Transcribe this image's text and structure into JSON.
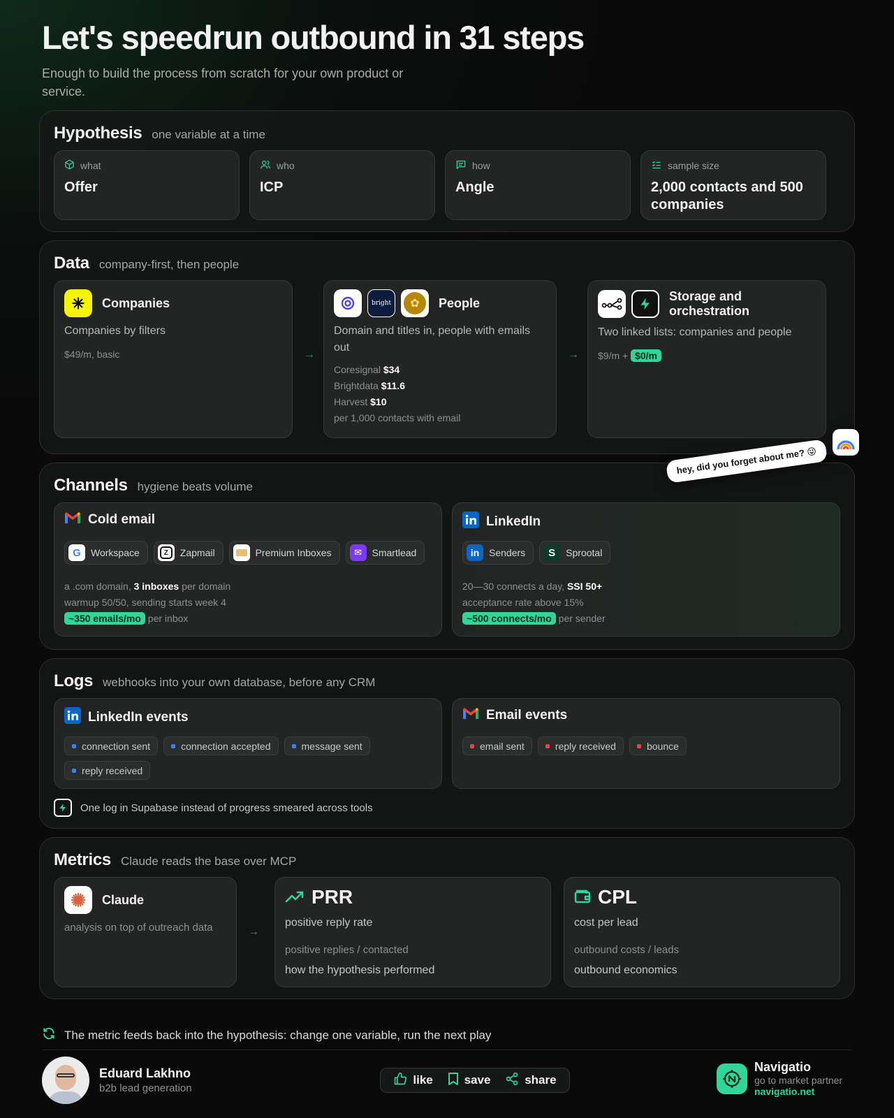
{
  "header": {
    "title": "Let's speedrun outbound in 31 steps",
    "subtitle": "Enough to build the process from scratch for your own product or service."
  },
  "hypothesis": {
    "title": "Hypothesis",
    "subtitle": "one variable at a time",
    "cards": [
      {
        "label": "what",
        "value": "Offer",
        "icon": "cube-icon"
      },
      {
        "label": "who",
        "value": "ICP",
        "icon": "users-icon"
      },
      {
        "label": "how",
        "value": "Angle",
        "icon": "message-icon"
      },
      {
        "label": "sample size",
        "value": "2,000 contacts and 500 companies",
        "icon": "checklist-icon"
      }
    ]
  },
  "data": {
    "title": "Data",
    "subtitle": "company-first, then people",
    "companies": {
      "title": "Companies",
      "desc": "Companies by filters",
      "price": "$49/m, basic"
    },
    "people": {
      "title": "People",
      "desc": "Domain and titles in, people with emails out",
      "vendors": [
        {
          "name": "Coresignal",
          "price": "$34"
        },
        {
          "name": "Brightdata",
          "price": "$11.6"
        },
        {
          "name": "Harvest",
          "price": "$10"
        }
      ],
      "note": "per 1,000 contacts with email",
      "logo_text": "bright"
    },
    "storage": {
      "title": "Storage and orchestration",
      "desc": "Two linked lists: companies and people",
      "price": "$9/m +",
      "free": "$0/m"
    }
  },
  "bubble": {
    "text": "hey, did you forget about me? 😜"
  },
  "channels": {
    "title": "Channels",
    "subtitle": "hygiene beats volume",
    "cold_email": {
      "title": "Cold email",
      "tools": [
        "Workspace",
        "Zapmail",
        "Premium Inboxes",
        "Smartlead"
      ],
      "line1_a": "a .com domain,",
      "line1_b": "3 inboxes",
      "line1_c": "per domain",
      "line2": "warmup 50/50, sending starts week 4",
      "badge": "~350 emails/mo",
      "badge_tail": "per inbox"
    },
    "linkedin": {
      "title": "LinkedIn",
      "tools": [
        "Senders",
        "Sprootal"
      ],
      "line1_a": "20—30 connects a day,",
      "line1_b": "SSI 50+",
      "line2": "acceptance rate above 15%",
      "badge": "~500 connects/mo",
      "badge_tail": "per sender"
    }
  },
  "logs": {
    "title": "Logs",
    "subtitle": "webhooks into your own database, before any CRM",
    "linkedin_events": {
      "title": "LinkedIn events",
      "events": [
        "connection sent",
        "connection accepted",
        "message sent",
        "reply received"
      ]
    },
    "email_events": {
      "title": "Email events",
      "events": [
        "email sent",
        "reply received",
        "bounce"
      ]
    },
    "note": "One log in Supabase instead of progress smeared across tools"
  },
  "metrics": {
    "title": "Metrics",
    "subtitle": "Claude reads the base over MCP",
    "claude": {
      "title": "Claude",
      "desc": "analysis on top of outreach data"
    },
    "prr": {
      "title": "PRR",
      "name": "positive reply rate",
      "formula": "positive replies / contacted",
      "meaning": "how the hypothesis performed"
    },
    "cpl": {
      "title": "CPL",
      "name": "cost per lead",
      "formula": "outbound costs / leads",
      "meaning": "outbound economics"
    }
  },
  "footer": {
    "loop": "The metric feeds back into the hypothesis: change one variable, run the next play",
    "author_name": "Eduard Lakhno",
    "author_role": "b2b lead generation",
    "actions": [
      "like",
      "save",
      "share"
    ],
    "brand_name": "Navigatio",
    "brand_sub": "go to market partner",
    "brand_url": "navigatio.net"
  },
  "colors": {
    "accent": "#34d399",
    "background": "#0a0a0a",
    "card": "#232524",
    "linkedin": "#0a66c2",
    "email_dot": "#ef4444",
    "linkedin_dot": "#3b82f6"
  }
}
